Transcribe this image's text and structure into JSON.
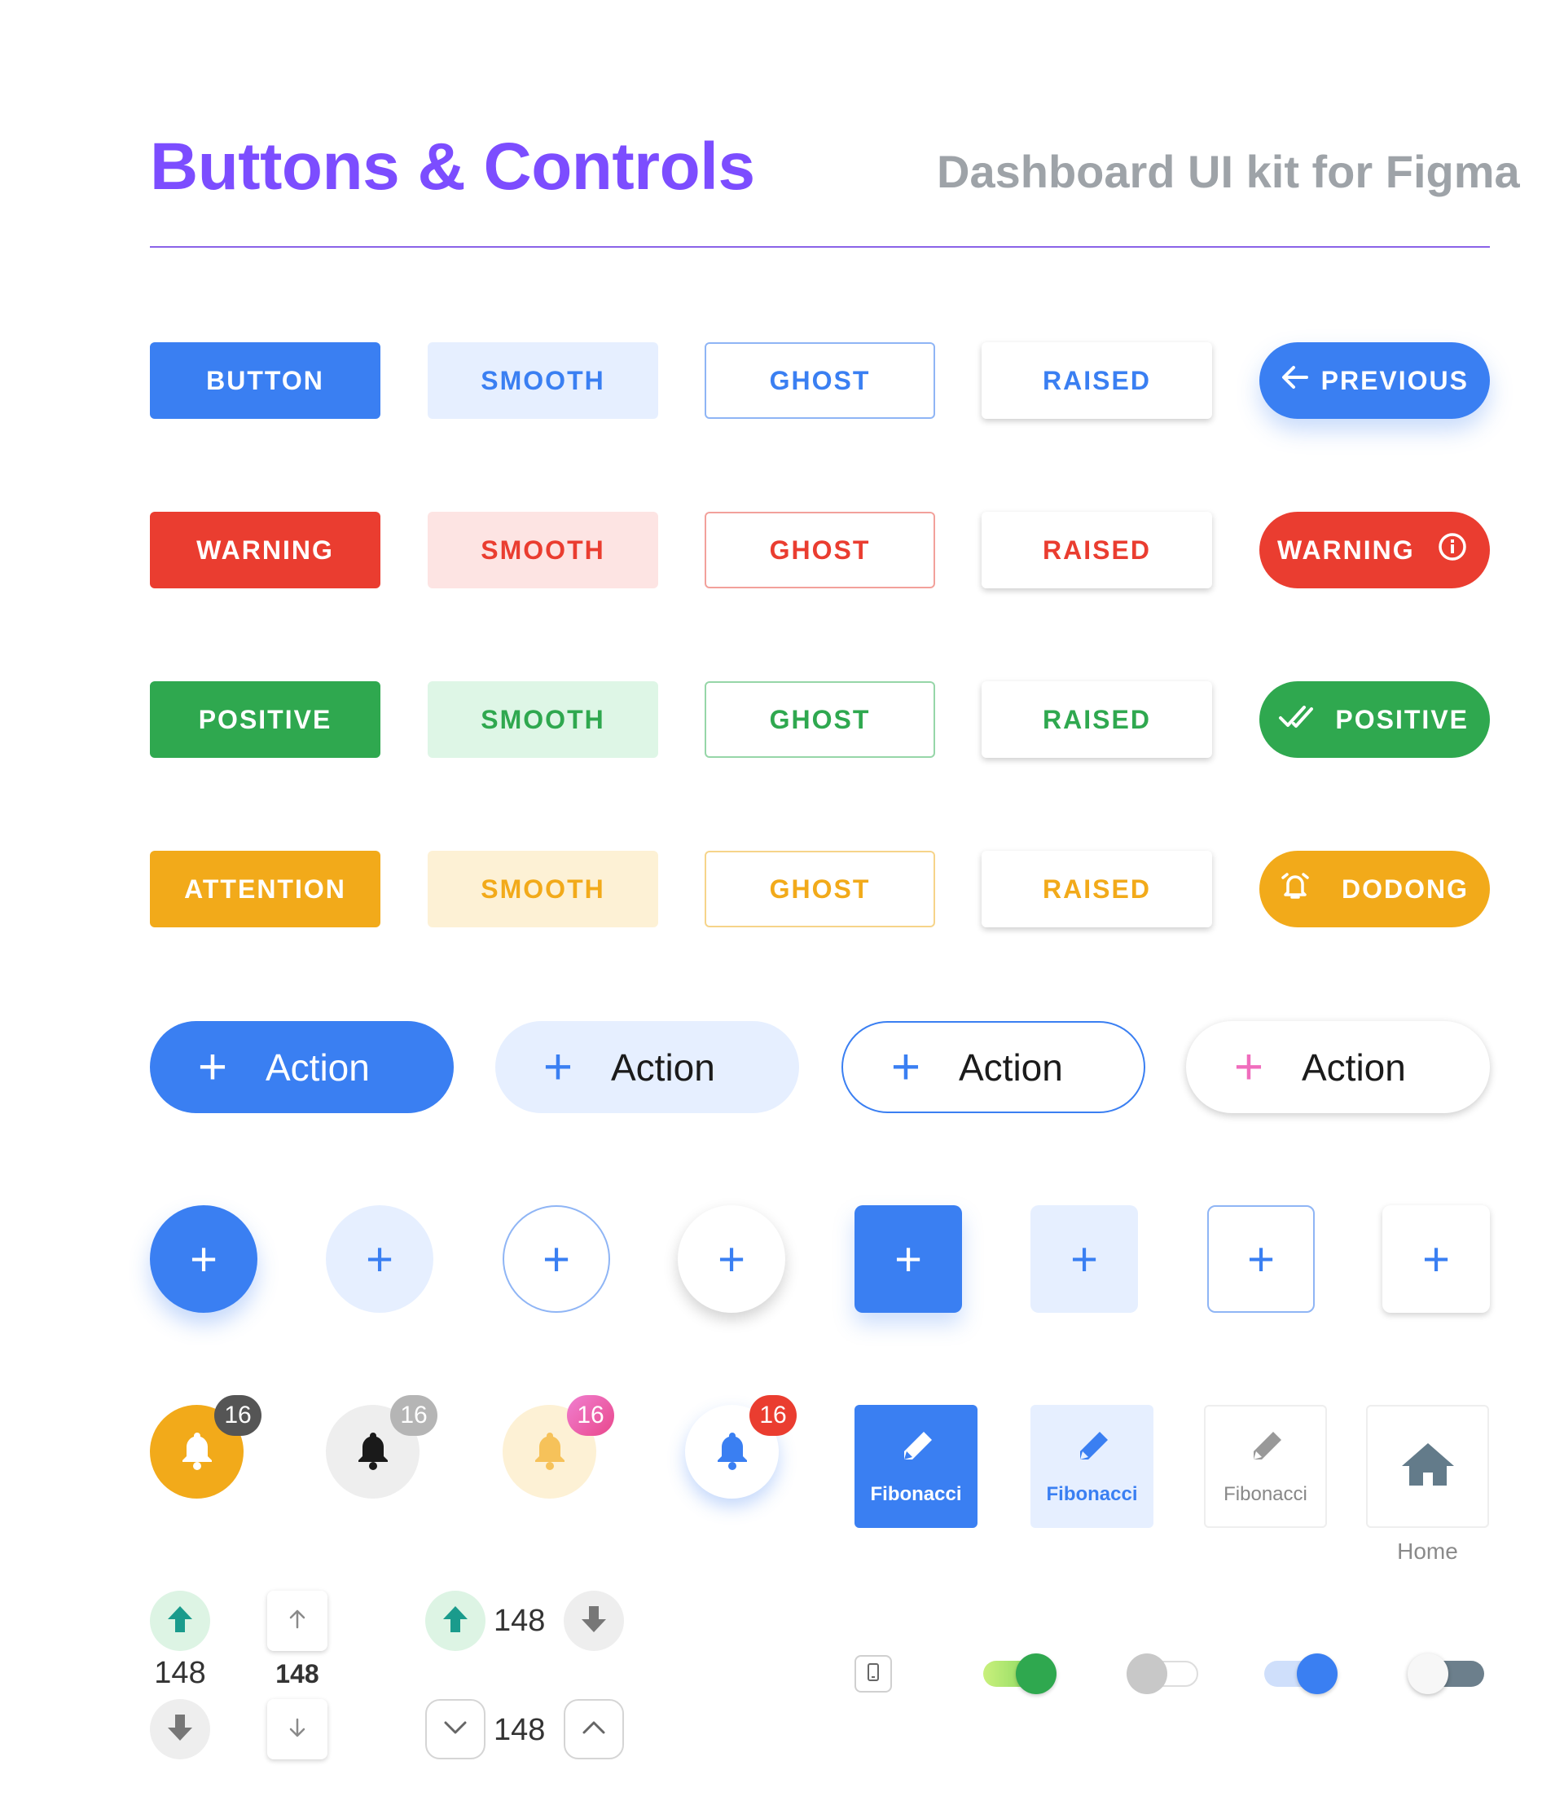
{
  "header": {
    "title": "Buttons & Controls",
    "subtitle": "Dashboard UI kit for Figma"
  },
  "colors": {
    "primary": "#3a7ff2",
    "warning": "#ea3d30",
    "positive": "#2fa84f",
    "attention": "#f2aa1a",
    "title_purple": "#7c4dff",
    "pink": "#f06dbd",
    "teal": "#1a9b8c"
  },
  "rows": [
    {
      "solid": "BUTTON",
      "smooth": "SMOOTH",
      "ghost": "GHOST",
      "raised": "RAISED",
      "pill": "PREVIOUS",
      "pill_icon": "arrow-left-icon"
    },
    {
      "solid": "WARNING",
      "smooth": "SMOOTH",
      "ghost": "GHOST",
      "raised": "RAISED",
      "pill": "WARNING",
      "pill_icon": "info-icon"
    },
    {
      "solid": "POSITIVE",
      "smooth": "SMOOTH",
      "ghost": "GHOST",
      "raised": "RAISED",
      "pill": "POSITIVE",
      "pill_icon": "double-check-icon"
    },
    {
      "solid": "ATTENTION",
      "smooth": "SMOOTH",
      "ghost": "GHOST",
      "raised": "RAISED",
      "pill": "DODONG",
      "pill_icon": "alarm-bell-icon"
    }
  ],
  "actions": [
    "Action",
    "Action",
    "Action",
    "Action"
  ],
  "notifications": {
    "count": "16"
  },
  "tiles": [
    "Fibonacci",
    "Fibonacci",
    "Fibonacci"
  ],
  "home": {
    "label": "Home"
  },
  "votes": {
    "a": "148",
    "b": "148",
    "c": "148",
    "d": "148"
  }
}
